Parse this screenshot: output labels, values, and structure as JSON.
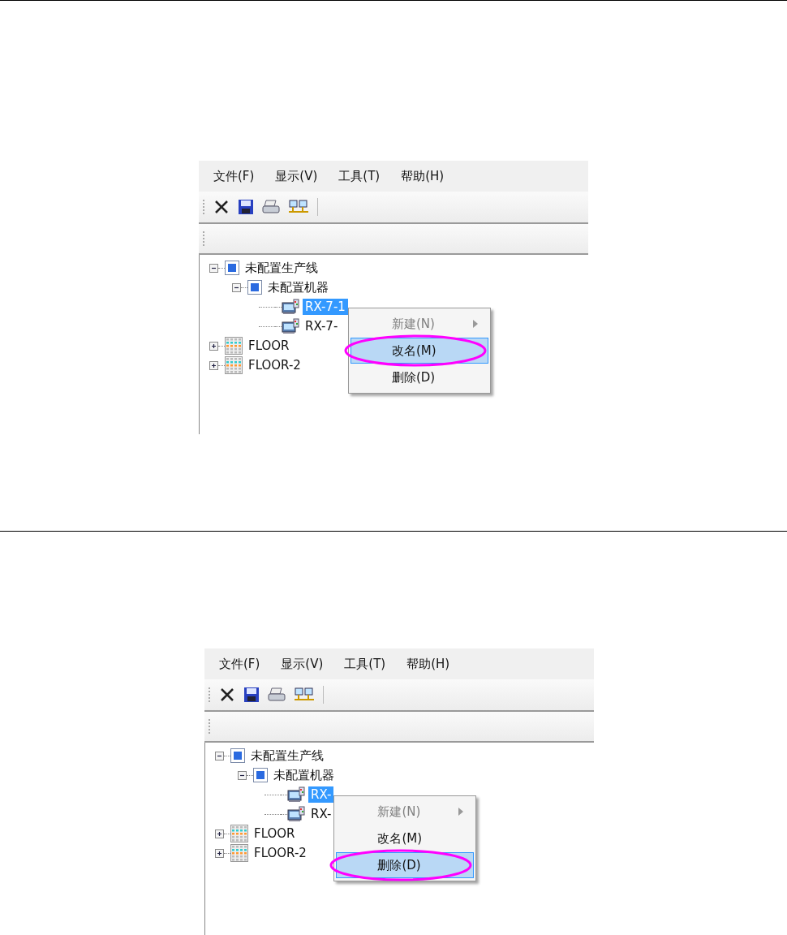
{
  "screens": [
    {
      "menu_bar": [
        "文件(F)",
        "显示(V)",
        "工具(T)",
        "帮助(H)"
      ],
      "tree": [
        {
          "label": "未配置生产线",
          "kind": "group",
          "expanded": true,
          "selected": false,
          "children": [
            {
              "label": "未配置机器",
              "kind": "group",
              "expanded": true,
              "selected": false,
              "children": [
                {
                  "label": "RX-7-1",
                  "kind": "machine",
                  "selected": true
                },
                {
                  "label": "RX-7-",
                  "kind": "machine",
                  "selected": false
                }
              ]
            }
          ]
        },
        {
          "label": "FLOOR",
          "kind": "floor",
          "expanded": false,
          "selected": false
        },
        {
          "label": "FLOOR-2",
          "kind": "floor",
          "expanded": false,
          "selected": false
        }
      ],
      "context_menu": [
        {
          "label": "新建(N)",
          "disabled": true,
          "submenu": true,
          "selected": false
        },
        {
          "label": "改名(M)",
          "disabled": false,
          "submenu": false,
          "selected": true
        },
        {
          "label": "删除(D)",
          "disabled": false,
          "submenu": false,
          "selected": false
        }
      ]
    },
    {
      "menu_bar": [
        "文件(F)",
        "显示(V)",
        "工具(T)",
        "帮助(H)"
      ],
      "tree": [
        {
          "label": "未配置生产线",
          "kind": "group",
          "expanded": true,
          "selected": false,
          "children": [
            {
              "label": "未配置机器",
              "kind": "group",
              "expanded": true,
              "selected": false,
              "children": [
                {
                  "label": "RX-",
                  "kind": "machine",
                  "selected": true
                },
                {
                  "label": "RX-",
                  "kind": "machine",
                  "selected": false
                }
              ]
            }
          ]
        },
        {
          "label": "FLOOR",
          "kind": "floor",
          "expanded": false,
          "selected": false
        },
        {
          "label": "FLOOR-2",
          "kind": "floor",
          "expanded": false,
          "selected": false
        }
      ],
      "context_menu": [
        {
          "label": "新建(N)",
          "disabled": true,
          "submenu": true,
          "selected": false
        },
        {
          "label": "改名(M)",
          "disabled": false,
          "submenu": false,
          "selected": false
        },
        {
          "label": "删除(D)",
          "disabled": false,
          "submenu": false,
          "selected": true
        }
      ]
    }
  ]
}
